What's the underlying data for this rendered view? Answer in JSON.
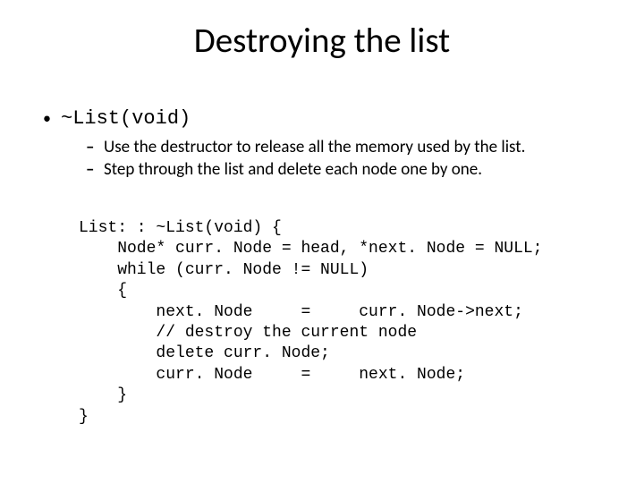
{
  "title": "Destroying the list",
  "bullet1": "~List(void)",
  "sub1": "Use the destructor to release all the memory used by the list.",
  "sub2": "Step through the list and delete each node one by one.",
  "code": "List: : ~List(void) {\n    Node* curr. Node = head, *next. Node = NULL;\n    while (curr. Node != NULL)\n    {\n        next. Node     =     curr. Node->next;\n        // destroy the current node\n        delete curr. Node;\n        curr. Node     =     next. Node;\n    }\n}"
}
